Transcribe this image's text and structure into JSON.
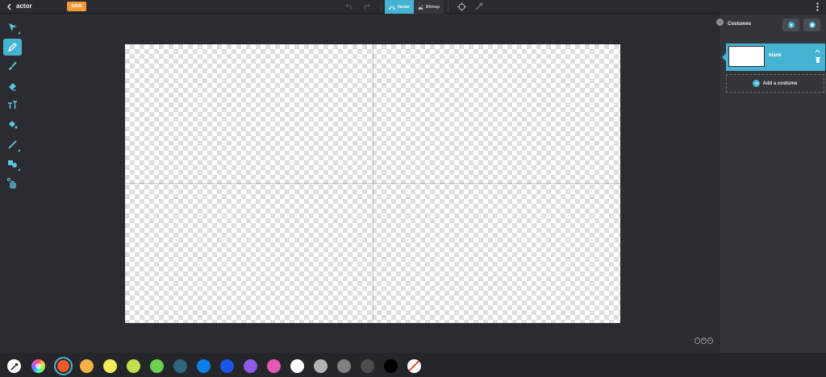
{
  "topbar": {
    "title": "actor",
    "save_label": "SAVE",
    "modes": [
      {
        "label": "Vector",
        "active": true
      },
      {
        "label": "Bitmap",
        "active": false
      }
    ]
  },
  "tools": [
    {
      "name": "select",
      "icon": "arrow-cursor-icon",
      "active": false
    },
    {
      "name": "pencil",
      "icon": "pencil-icon",
      "active": true
    },
    {
      "name": "brush",
      "icon": "brush-icon",
      "active": false
    },
    {
      "name": "eraser",
      "icon": "eraser-icon",
      "active": false
    },
    {
      "name": "text",
      "icon": "text-icon",
      "active": false
    },
    {
      "name": "fill",
      "icon": "paint-bucket-icon",
      "active": false
    },
    {
      "name": "line",
      "icon": "line-icon",
      "active": false
    },
    {
      "name": "shapes",
      "icon": "shapes-icon",
      "active": false
    },
    {
      "name": "hand",
      "icon": "hand-icon",
      "active": false
    }
  ],
  "panel": {
    "title": "Costumes",
    "costumes": [
      {
        "name": "blank",
        "selected": true
      }
    ],
    "add_label": "Add a costume"
  },
  "palette": {
    "colors": [
      "#ef5a2a",
      "#f5b048",
      "#f4ed59",
      "#c0e04f",
      "#6fd14f",
      "#2e6780",
      "#0b7fe8",
      "#1b54e6",
      "#8e5ae6",
      "#e25ab3",
      "#ffffff",
      "#b2b2b2",
      "#808080",
      "#4d4d4d",
      "#000000"
    ],
    "selected": "#ef5a2a",
    "accent": "#45b4d3"
  }
}
